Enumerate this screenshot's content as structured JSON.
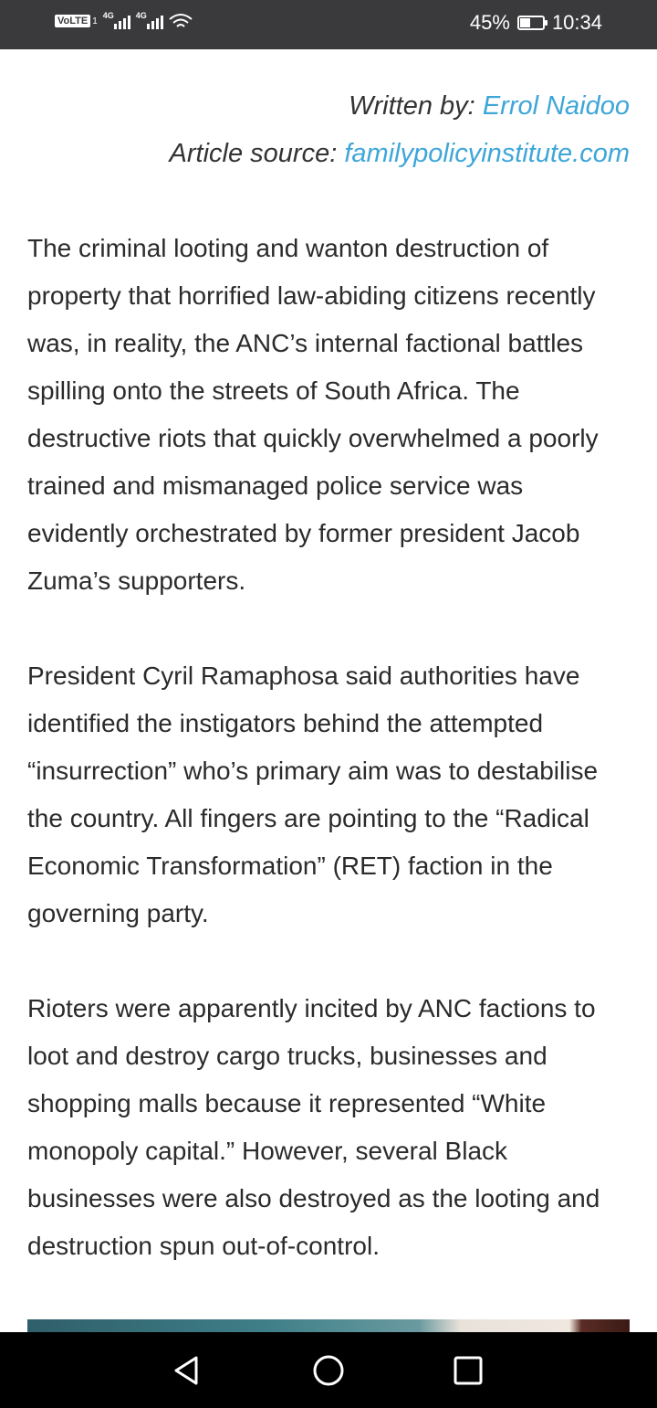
{
  "status_bar": {
    "carrier_badge": "VoLTE",
    "sim_slot": "1",
    "network_1": "4G",
    "network_2": "4G",
    "battery_percent": "45%",
    "battery_level": 0.45,
    "time": "10:34",
    "icons": [
      "volte-icon",
      "signal-icon",
      "signal-icon",
      "wifi-icon",
      "battery-icon"
    ]
  },
  "article": {
    "written_by_label": "Written by:",
    "author": "Errol Naidoo",
    "source_label": "Article source:",
    "source": "familypolicyinstitute.com",
    "paragraphs": [
      "The criminal looting and wanton destruction of property that horrified law-abiding citizens recently was, in reality, the ANC’s internal factional battles spilling onto the streets of South Africa. The destructive riots that quickly overwhelmed a poorly trained and mismanaged police service was evidently orchestrated by former president Jacob Zuma’s supporters.",
      "President Cyril Ramaphosa said authorities have identified the instigators behind the attempted “insurrection” who’s primary aim was to destabilise the country. All fingers are pointing to the “Radical Economic Transformation” (RET) faction in the governing party.",
      "Rioters were apparently incited by ANC factions to loot and destroy cargo trucks, businesses and shopping malls because it represented “White monopoly capital.” However, several Black businesses were also destroyed as the looting and destruction spun out-of-control."
    ],
    "link_color": "#3ea6d8"
  },
  "nav_bar": {
    "icons": [
      "back-icon",
      "home-icon",
      "recents-icon"
    ]
  }
}
